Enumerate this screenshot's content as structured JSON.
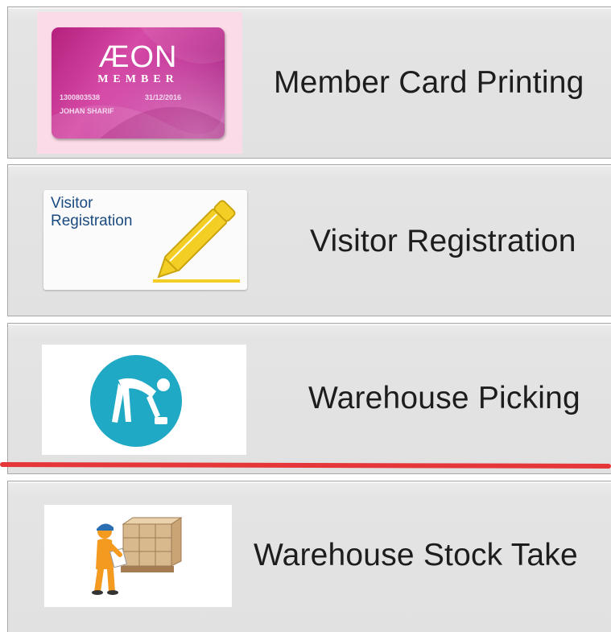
{
  "menu": {
    "items": [
      {
        "label": "Member Card Printing",
        "icon": "aeon-member-card-icon",
        "card": {
          "brand": "ÆON",
          "sub": "MEMBER",
          "number": "1300803538",
          "date": "31/12/2016",
          "name": "JOHAN SHARIF"
        }
      },
      {
        "label": "Visitor Registration",
        "icon": "pencil-icon",
        "thumb_text_line1": "Visitor",
        "thumb_text_line2": "Registration"
      },
      {
        "label": "Warehouse Picking",
        "icon": "person-picking-icon"
      },
      {
        "label": "Warehouse Stock Take",
        "icon": "worker-with-boxes-icon"
      }
    ]
  },
  "colors": {
    "item_background": "#e2e2e2",
    "item_border": "#a8a8a8",
    "picking_circle": "#1fa9c4",
    "pencil_yellow": "#f3cf25",
    "annotation_red": "#e5373a",
    "card_magenta": "#c53a9a"
  }
}
